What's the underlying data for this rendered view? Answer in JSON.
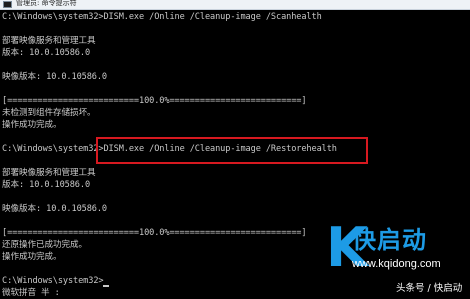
{
  "window": {
    "title": "管理员: 命令提示符",
    "icon": "cmd-icon"
  },
  "console": {
    "lines": [
      "C:\\Windows\\system32>DISM.exe /Online /Cleanup-image /Scanhealth",
      "",
      "部署映像服务和管理工具",
      "版本: 10.0.10586.0",
      "",
      "映像版本: 10.0.10586.0",
      "",
      "[==========================100.0%==========================]",
      "未检测到组件存储损坏。",
      "操作成功完成。",
      "",
      "C:\\Windows\\system32>DISM.exe /Online /Cleanup-image /Restorehealth",
      "",
      "部署映像服务和管理工具",
      "版本: 10.0.10586.0",
      "",
      "映像版本: 10.0.10586.0",
      "",
      "[==========================100.0%==========================]",
      "还原操作已成功完成。",
      "操作成功完成。",
      "",
      "C:\\Windows\\system32>",
      "微软拼音 半 :"
    ]
  },
  "highlight": {
    "color": "#d71920",
    "target": "restorehealth-command"
  },
  "watermark": {
    "logo_letter": "K",
    "title": "快启动",
    "url": "www.kqidong.com",
    "color": "#1d9be6"
  },
  "footer": {
    "badge": "头条号 / 快启动"
  }
}
